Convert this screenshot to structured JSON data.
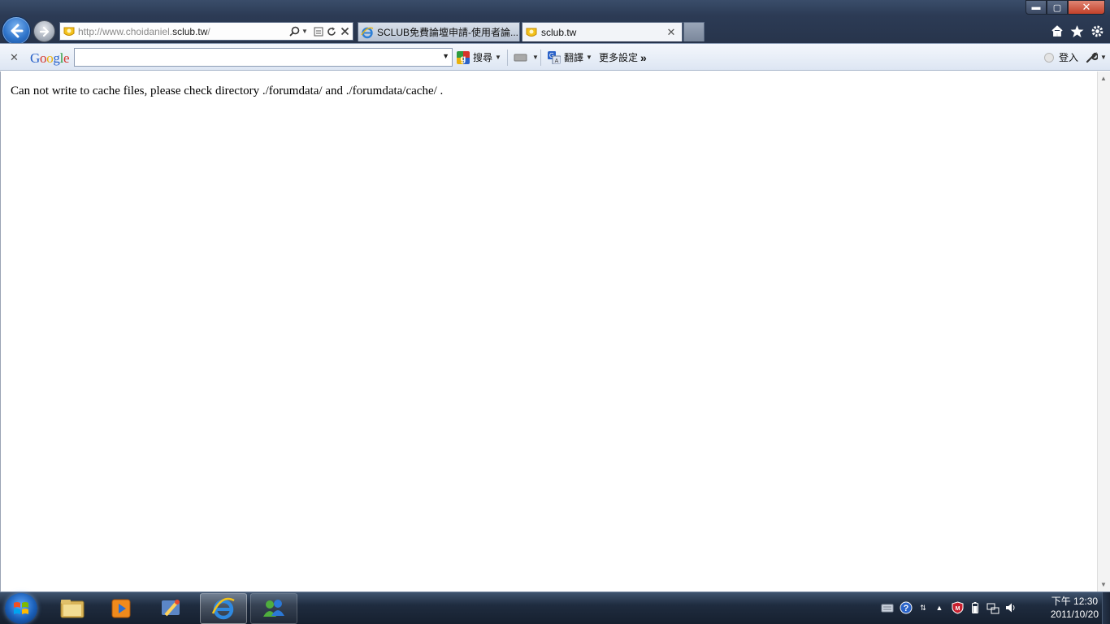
{
  "browser": {
    "address_prefix": "http://www.choidaniel.",
    "address_domain": "sclub.tw",
    "address_suffix": "/",
    "tabs": [
      {
        "title": "SCLUB免費論壇申請-使用者論..."
      },
      {
        "title": "sclub.tw"
      }
    ],
    "window_controls": {
      "minimize": "▬",
      "maximize": "▢",
      "close": "✕"
    }
  },
  "google_toolbar": {
    "logo": "Google",
    "search_value": "",
    "search_label": "搜尋",
    "translate_label": "翻譯",
    "more_settings_label": "更多設定",
    "more_chevron": "»",
    "signin_label": "登入"
  },
  "content": {
    "error_message": "Can not write to cache files, please check directory ./forumdata/ and ./forumdata/cache/ ."
  },
  "taskbar": {
    "clock_time": "下午 12:30",
    "clock_date": "2011/10/20"
  },
  "colors": {
    "logo_blue": "#2a62c9",
    "logo_red": "#d6342b",
    "logo_yellow": "#e9b10b",
    "logo_green": "#2e9b40"
  }
}
